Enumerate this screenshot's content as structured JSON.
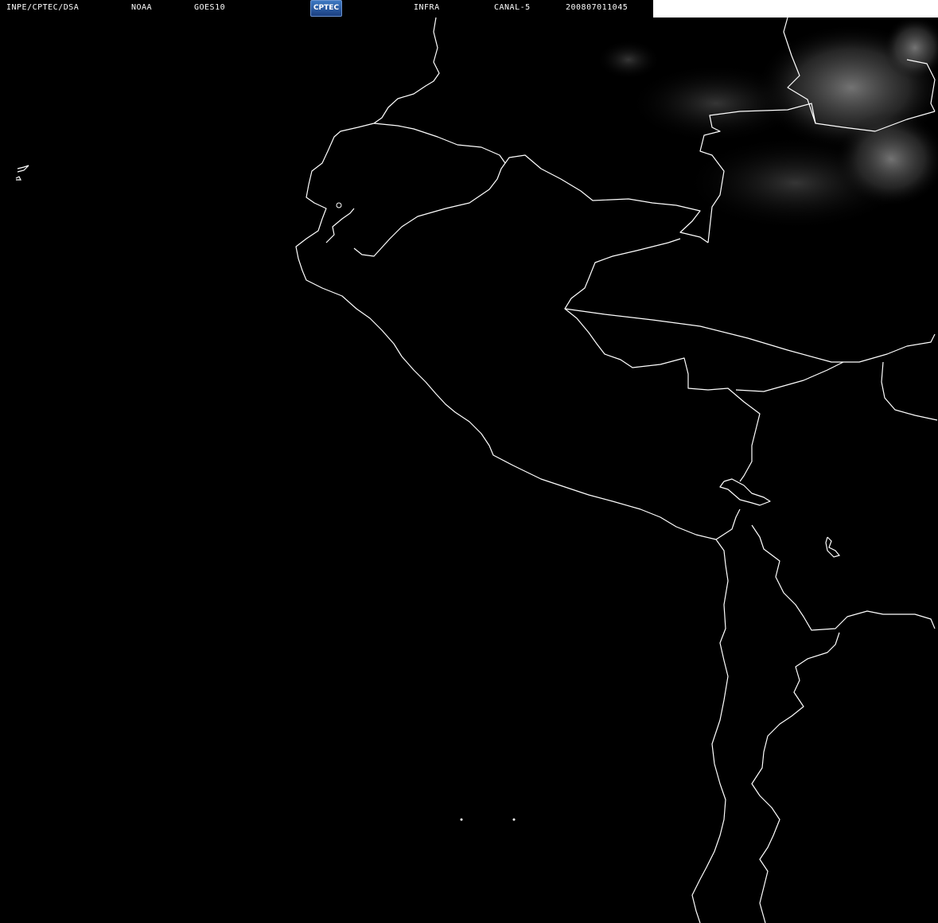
{
  "header": {
    "org": "INPE/CPTEC/DSA",
    "agency": "NOAA",
    "satellite": "GOES10",
    "logo": "CPTEC",
    "product": "INFRA",
    "channel": "CANAL-5",
    "timestamp": "200807011045"
  },
  "colors": {
    "background": "#000000",
    "border_lines": "#ffffff",
    "header_text": "#ffffff",
    "header_blank": "#ffffff",
    "logo_blue": "#2f5ea8",
    "cloud_gray": "#9a9a9a"
  }
}
